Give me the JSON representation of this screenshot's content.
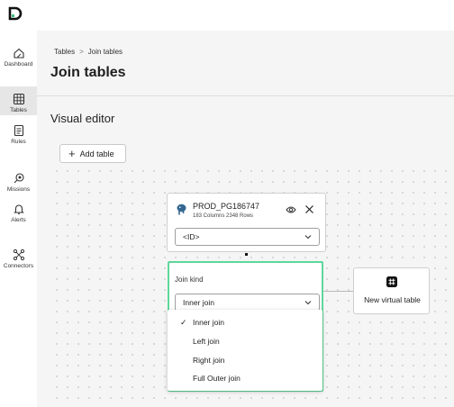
{
  "sidebar": {
    "items": [
      {
        "label": "Dashboard",
        "icon": "dashboard-icon"
      },
      {
        "label": "Tables",
        "icon": "table-icon"
      },
      {
        "label": "Rules",
        "icon": "rules-icon"
      },
      {
        "label": "Missions",
        "icon": "missions-icon"
      },
      {
        "label": "Alerts",
        "icon": "bell-icon"
      },
      {
        "label": "Connectors",
        "icon": "connectors-icon"
      }
    ],
    "active": "Tables"
  },
  "breadcrumb": {
    "items": [
      "Tables",
      "Join tables"
    ],
    "separator": ">"
  },
  "page": {
    "title": "Join tables",
    "section_title": "Visual editor"
  },
  "toolbar": {
    "add_table_label": "Add table"
  },
  "table_card": {
    "name": "PROD_PG186747",
    "meta": "183 Columns 2348 Rows",
    "key_select_value": "<ID>"
  },
  "join": {
    "label": "Join kind",
    "selected": "Inner join",
    "options": [
      "Inner join",
      "Left join",
      "Right join",
      "Full Outer join"
    ]
  },
  "virtual_table": {
    "label": "New virtual table"
  },
  "colors": {
    "accent": "#5ed79b",
    "brand": "#111111"
  }
}
